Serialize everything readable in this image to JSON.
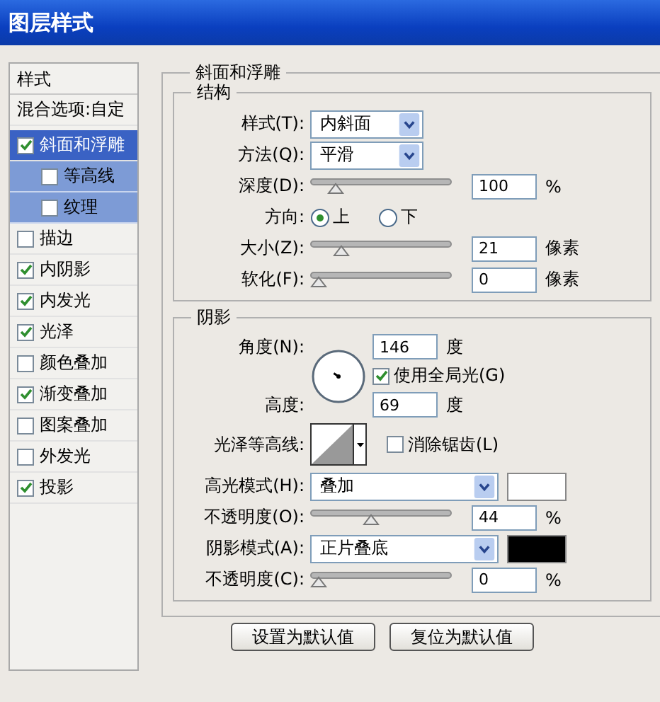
{
  "window": {
    "title": "图层样式"
  },
  "sidebar": {
    "header": "样式",
    "blending_options": "混合选项:自定",
    "effects": [
      {
        "label": "斜面和浮雕",
        "checked": true,
        "selected": true,
        "children": [
          {
            "label": "等高线",
            "checked": false,
            "selected": false
          },
          {
            "label": "纹理",
            "checked": false,
            "selected": false
          }
        ]
      },
      {
        "label": "描边",
        "checked": false,
        "selected": false
      },
      {
        "label": "内阴影",
        "checked": true,
        "selected": false
      },
      {
        "label": "内发光",
        "checked": true,
        "selected": false
      },
      {
        "label": "光泽",
        "checked": true,
        "selected": false
      },
      {
        "label": "颜色叠加",
        "checked": false,
        "selected": false
      },
      {
        "label": "渐变叠加",
        "checked": true,
        "selected": false
      },
      {
        "label": "图案叠加",
        "checked": false,
        "selected": false
      },
      {
        "label": "外发光",
        "checked": false,
        "selected": false
      },
      {
        "label": "投影",
        "checked": true,
        "selected": false
      }
    ]
  },
  "panel": {
    "title": "斜面和浮雕",
    "structure": {
      "title": "结构",
      "rows": [
        {
          "kind": "select",
          "label": "样式(T):",
          "value": "内斜面"
        },
        {
          "kind": "select",
          "label": "方法(Q):",
          "value": "平滑"
        },
        {
          "kind": "slider",
          "label": "深度(D):",
          "level": 0.14,
          "value": "100",
          "unit": "%"
        },
        {
          "kind": "radio",
          "label": "方向:",
          "options": [
            {
              "label": "上",
              "selected": true
            },
            {
              "label": "下",
              "selected": false
            }
          ]
        },
        {
          "kind": "slider",
          "label": "大小(Z):",
          "level": 0.18,
          "value": "21",
          "unit": "像素"
        },
        {
          "kind": "slider",
          "label": "软化(F):",
          "level": 0,
          "value": "0",
          "unit": "像素"
        }
      ]
    },
    "shading": {
      "title": "阴影",
      "angle": {
        "label": "角度(N):",
        "value": "146",
        "unit": "度"
      },
      "global_light": {
        "label": "使用全局光(G)",
        "checked": true
      },
      "altitude": {
        "label": "高度:",
        "value": "69",
        "unit": "度"
      },
      "gloss_contour": {
        "label": "光泽等高线:"
      },
      "anti_aliased": {
        "label": "消除锯齿(L)",
        "checked": false
      },
      "rows": [
        {
          "kind": "select",
          "label": "高光模式(H):",
          "value": "叠加",
          "color": "#ffffff"
        },
        {
          "kind": "slider",
          "label": "不透明度(O):",
          "level": 0.42,
          "value": "44",
          "unit": "%"
        },
        {
          "kind": "select",
          "label": "阴影模式(A):",
          "value": "正片叠底",
          "color": "#000000"
        },
        {
          "kind": "slider",
          "label": "不透明度(C):",
          "level": 0,
          "value": "0",
          "unit": "%"
        }
      ]
    }
  },
  "buttons": [
    "设置为默认值",
    "复位为默认值"
  ]
}
